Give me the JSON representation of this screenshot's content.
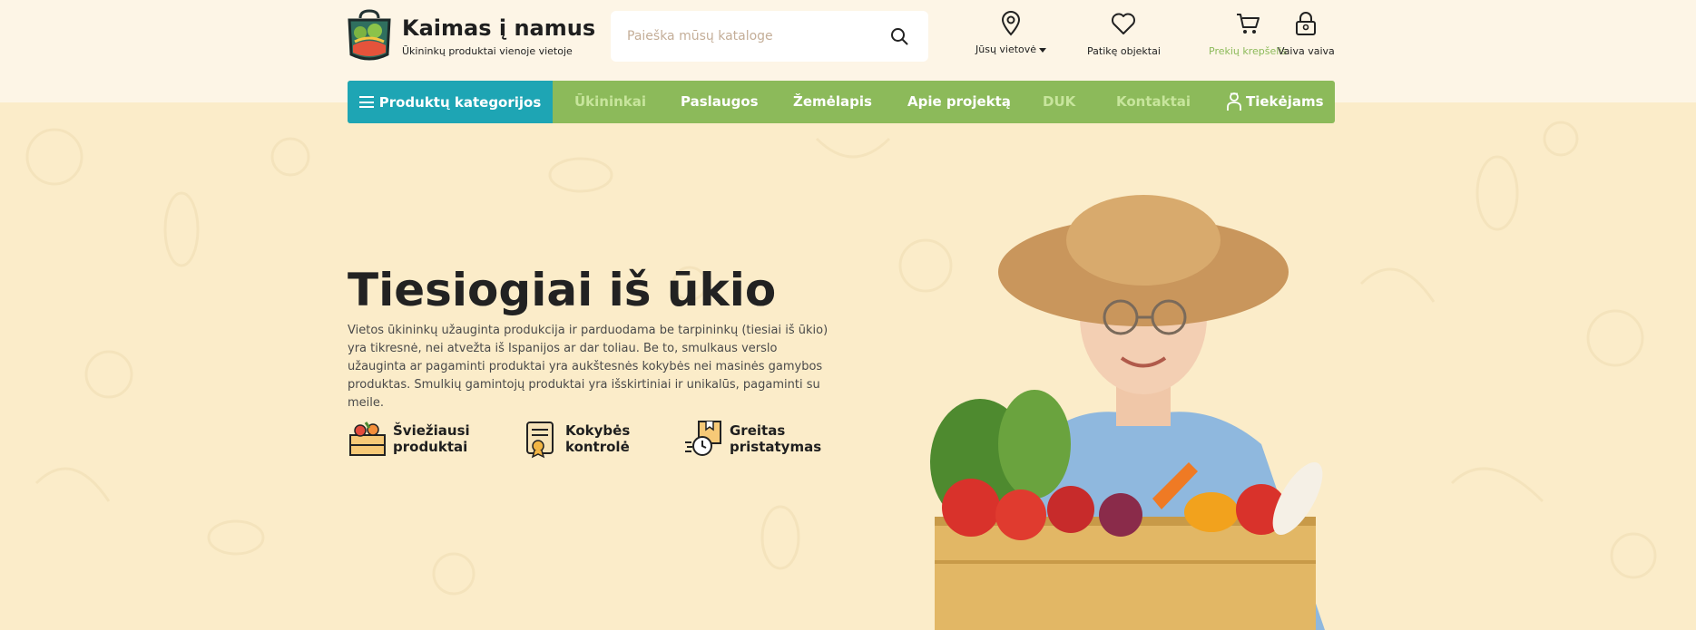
{
  "brand": {
    "title": "Kaimas į namus",
    "subtitle": "Ūkininkų produktai vienoje vietoje"
  },
  "search": {
    "placeholder": "Paieška mūsų kataloge",
    "icon": "search-icon"
  },
  "header_actions": [
    {
      "label": "Jūsų vietovė",
      "icon": "location-pin-icon"
    },
    {
      "label": "Patikę objektai",
      "icon": "heart-icon"
    },
    {
      "label": "Prekių krepšelis",
      "icon": "cart-icon"
    },
    {
      "label": "Vaiva vaiva",
      "icon": "user-lock-icon"
    }
  ],
  "nav": {
    "categories_label": "Produktų kategorijos",
    "items": [
      "Ūkininkai",
      "Paslaugos",
      "Žemėlapis",
      "Apie projektą",
      "DUK",
      "Kontaktai",
      "Tiekėjams"
    ]
  },
  "hero": {
    "title": "Tiesiogiai iš ūkio",
    "text": "Vietos ūkininkų užauginta produkcija ir parduodama be tarpininkų (tiesiai iš ūkio) yra tikresnė, nei atvežta iš Ispanijos ar dar toliau. Be to, smulkaus verslo užauginta ar pagaminti produktai yra aukštesnės kokybės nei masinės gamybos produktas. Smulkių gamintojų produktai yra išskirtiniai ir unikalūs, pagaminti su meile.",
    "features": [
      {
        "label": "Šviežiausi produktai",
        "icon": "fresh-crate-icon"
      },
      {
        "label": "Kokybės kontrolė",
        "icon": "quality-certificate-icon"
      },
      {
        "label": "Greitas pristatymas",
        "icon": "fast-delivery-icon"
      }
    ]
  },
  "colors": {
    "header_bg": "#fdf5e6",
    "hero_bg": "#fbecc9",
    "nav_green": "#8cba5a",
    "nav_teal": "#1ea5b4",
    "nav_dim_text": "#c7e59c"
  }
}
